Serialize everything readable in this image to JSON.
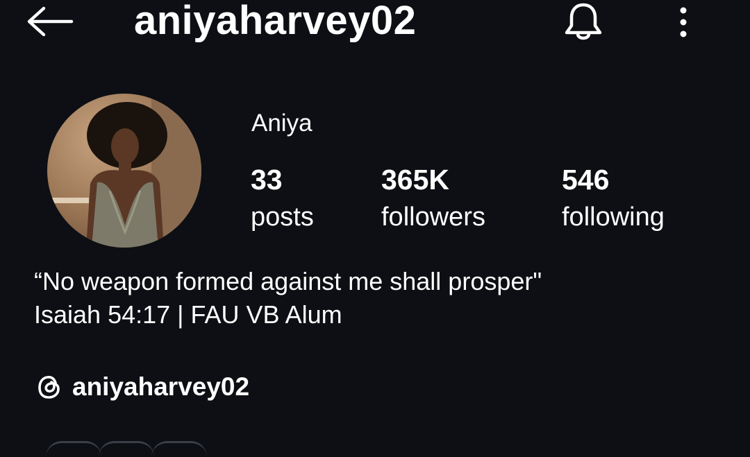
{
  "header": {
    "username": "aniyaharvey02",
    "back_icon": "arrow-left-icon",
    "bell_icon": "bell-icon",
    "more_icon": "more-vertical-icon"
  },
  "profile": {
    "display_name": "Aniya",
    "stats": {
      "posts": {
        "value": "33",
        "label": "posts"
      },
      "followers": {
        "value": "365K",
        "label": "followers"
      },
      "following": {
        "value": "546",
        "label": "following"
      }
    },
    "bio": {
      "line1": "“No weapon formed against me shall prosper\"",
      "line2": "Isaiah 54:17 | FAU VB Alum"
    },
    "threads": {
      "icon": "threads-icon",
      "handle": "aniyaharvey02"
    }
  },
  "colors": {
    "background": "#0d0f14",
    "text": "#ffffff"
  }
}
